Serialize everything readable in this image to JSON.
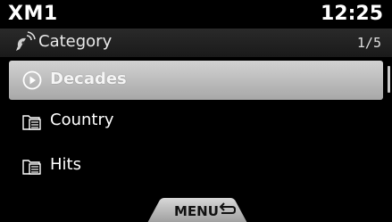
{
  "status": {
    "station": "XM1",
    "time": "12:25"
  },
  "header": {
    "label": "Category",
    "page": "1/5"
  },
  "list": [
    {
      "label": "Decades",
      "icon": "play-circle-icon",
      "selected": true
    },
    {
      "label": "Country",
      "icon": "folder-list-icon",
      "selected": false
    },
    {
      "label": "Hits",
      "icon": "folder-list-icon",
      "selected": false
    }
  ],
  "footer": {
    "menu_label": "MENU"
  },
  "colors": {
    "background": "#000000",
    "selected_row": "#c0c0c0",
    "header_bar": "#222222",
    "text": "#ffffff"
  }
}
